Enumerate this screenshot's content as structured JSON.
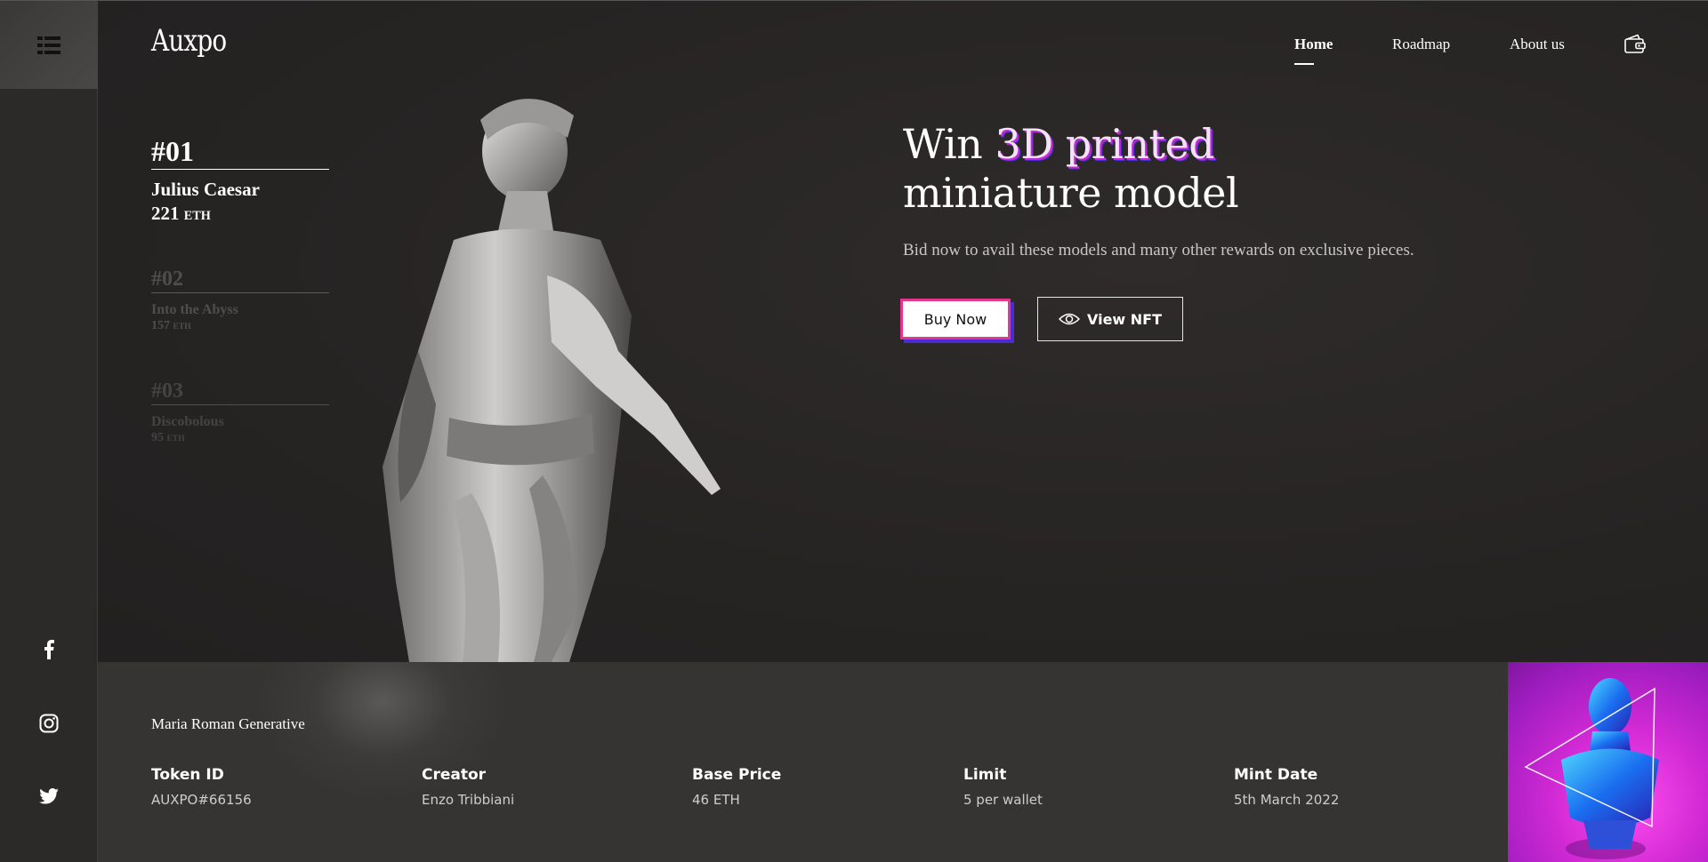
{
  "brand": {
    "logo": "Auxpo"
  },
  "nav": {
    "home": "Home",
    "roadmap": "Roadmap",
    "about": "About us"
  },
  "items": [
    {
      "num": "#01",
      "name": "Julius Caesar",
      "price": "221",
      "unit": "ETH"
    },
    {
      "num": "#02",
      "name": "Into the Abyss",
      "price": "157",
      "unit": "ETH"
    },
    {
      "num": "#03",
      "name": "Discobolous",
      "price": "95",
      "unit": "ETH"
    }
  ],
  "hero": {
    "headline_pre": "Win ",
    "headline_accent": "3D printed",
    "headline_line2": "miniature model",
    "subtitle": "Bid now to avail these models and many other rewards on exclusive pieces.",
    "buy_label": "Buy Now",
    "view_label": "View NFT"
  },
  "details": {
    "collection": "Maria Roman Generative",
    "stats": [
      {
        "label": "Token ID",
        "value": "AUXPO#66156"
      },
      {
        "label": "Creator",
        "value": "Enzo Tribbiani"
      },
      {
        "label": "Base Price",
        "value": "46 ETH"
      },
      {
        "label": "Limit",
        "value": "5 per wallet"
      },
      {
        "label": "Mint Date",
        "value": "5th March 2022"
      }
    ]
  },
  "icons": {
    "menu": "list-menu-icon",
    "cart": "wallet-icon",
    "social": [
      "facebook-icon",
      "instagram-icon",
      "twitter-icon"
    ],
    "view": "eye-icon"
  },
  "colors": {
    "background": "#2a2827",
    "accent_pink": "#e4368d",
    "accent_purple": "#4a2bd6",
    "thumb_magenta": "#d22ad5"
  }
}
